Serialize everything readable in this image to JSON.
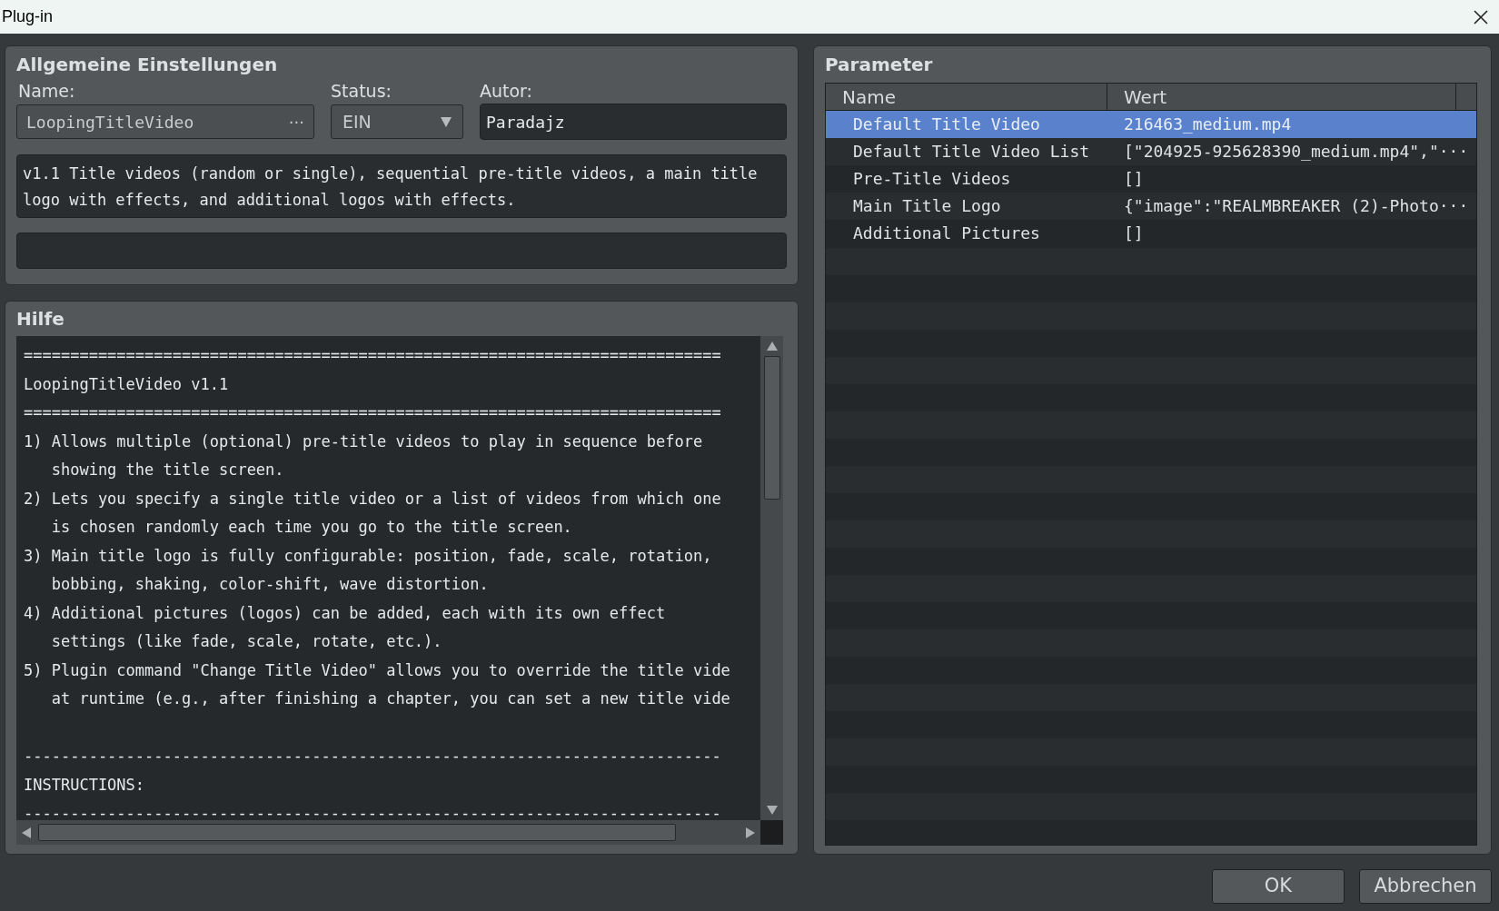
{
  "window": {
    "title": "Plug-in"
  },
  "general": {
    "title": "Allgemeine Einstellungen",
    "name": {
      "label": "Name:",
      "value": "LoopingTitleVideo",
      "button": "···"
    },
    "status": {
      "label": "Status:",
      "value": "EIN"
    },
    "author": {
      "label": "Autor:",
      "value": "Paradajz"
    },
    "description_lines": [
      "v1.1 Title videos (random or single), sequential pre-title videos, a main title",
      "logo with effects, and additional logos with effects."
    ]
  },
  "help": {
    "title": "Hilfe",
    "lines": [
      "===========================================================================",
      "LoopingTitleVideo v1.1",
      "===========================================================================",
      "1) Allows multiple (optional) pre-title videos to play in sequence before",
      "   showing the title screen.",
      "2) Lets you specify a single title video or a list of videos from which one",
      "   is chosen randomly each time you go to the title screen.",
      "3) Main title logo is fully configurable: position, fade, scale, rotation,",
      "   bobbing, shaking, color-shift, wave distortion.",
      "4) Additional pictures (logos) can be added, each with its own effect",
      "   settings (like fade, scale, rotate, etc.).",
      "5) Plugin command \"Change Title Video\" allows you to override the title vide",
      "   at runtime (e.g., after finishing a chapter, you can set a new title vide"
    ],
    "instruction_lines": [
      "---------------------------------------------------------------------------",
      "INSTRUCTIONS:",
      "---------------------------------------------------------------------------"
    ]
  },
  "parameters": {
    "title": "Parameter",
    "columns": [
      "Name",
      "Wert"
    ],
    "rows": [
      {
        "name": "Default Title Video",
        "value": "216463_medium.mp4",
        "selected": true
      },
      {
        "name": "Default Title Video List",
        "value": "[\"204925-925628390_medium.mp4\",\"···",
        "selected": false
      },
      {
        "name": "Pre-Title Videos",
        "value": "[]",
        "selected": false
      },
      {
        "name": "Main Title Logo",
        "value": "{\"image\":\"REALMBREAKER (2)-Photo···",
        "selected": false
      },
      {
        "name": "Additional Pictures",
        "value": "[]",
        "selected": false
      }
    ]
  },
  "buttons": [
    "OK",
    "Abbrechen"
  ]
}
